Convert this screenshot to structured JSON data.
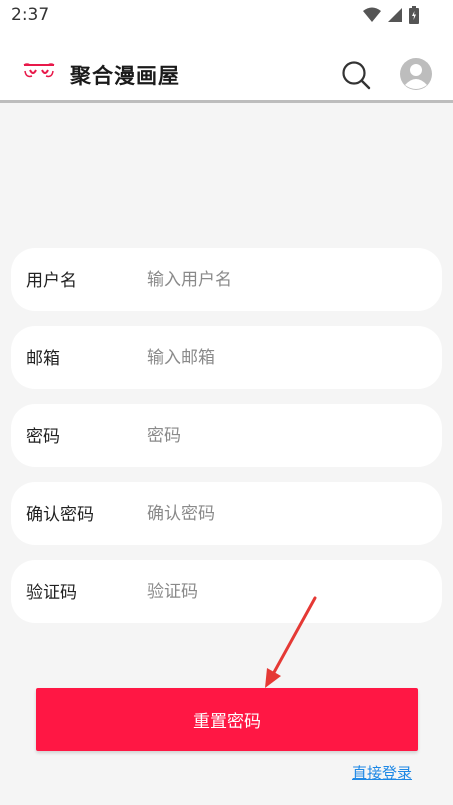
{
  "status_bar": {
    "time": "2:37",
    "icons": [
      "wifi-icon",
      "signal-icon",
      "battery-icon"
    ]
  },
  "app_bar": {
    "title": "聚合漫画屋",
    "logo_icon": "logo-icon",
    "search_icon": "search-icon",
    "avatar_icon": "avatar-icon"
  },
  "form": {
    "fields": [
      {
        "label": "用户名",
        "placeholder": "输入用户名",
        "value": ""
      },
      {
        "label": "邮箱",
        "placeholder": "输入邮箱",
        "value": ""
      },
      {
        "label": "密码",
        "placeholder": "密码",
        "value": ""
      },
      {
        "label": "确认密码",
        "placeholder": "确认密码",
        "value": ""
      },
      {
        "label": "验证码",
        "placeholder": "验证码",
        "value": ""
      }
    ],
    "submit_label": "重置密码",
    "login_link": "直接登录"
  },
  "colors": {
    "accent": "#ff1744",
    "link": "#1e88e5",
    "background": "#f5f5f5",
    "annotation_arrow": "#e53935"
  }
}
